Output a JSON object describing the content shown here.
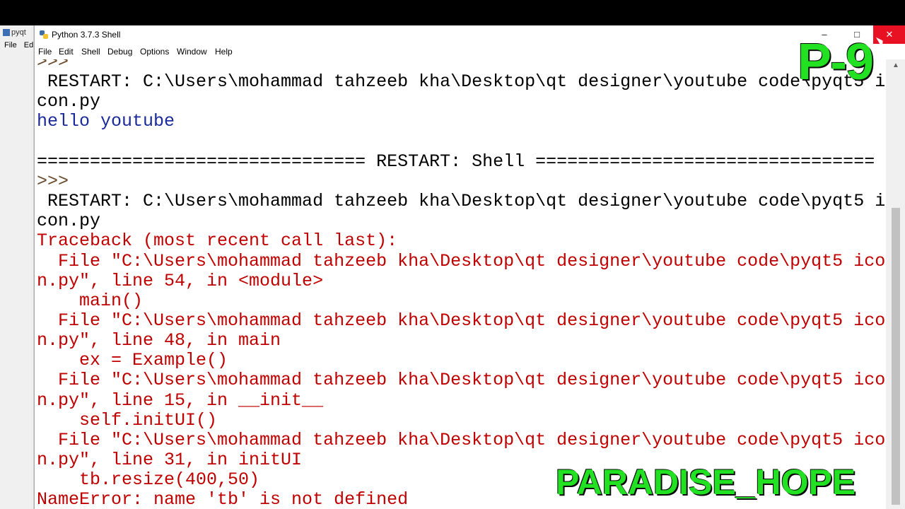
{
  "background_window": {
    "title": "pyqt",
    "menu": [
      "File",
      "Ed"
    ]
  },
  "window": {
    "title": "Python 3.7.3 Shell",
    "controls": {
      "minimize": "–",
      "maximize": "□",
      "close": "✕"
    }
  },
  "menubar": [
    "File",
    "Edit",
    "Shell",
    "Debug",
    "Options",
    "Window",
    "Help"
  ],
  "console_lines": [
    {
      "text": ">>>",
      "style": "prompt"
    },
    {
      "text": " RESTART: C:\\Users\\mohammad tahzeeb kha\\Desktop\\qt designer\\youtube code\\pyqt5 i",
      "style": "black"
    },
    {
      "text": "con.py",
      "style": "black"
    },
    {
      "text": "hello youtube",
      "style": "blue"
    },
    {
      "text": "",
      "style": "black"
    },
    {
      "text": "=============================== RESTART: Shell ================================",
      "style": "black"
    },
    {
      "text": ">>>",
      "style": "prompt"
    },
    {
      "text": " RESTART: C:\\Users\\mohammad tahzeeb kha\\Desktop\\qt designer\\youtube code\\pyqt5 i",
      "style": "black"
    },
    {
      "text": "con.py",
      "style": "black"
    },
    {
      "text": "Traceback (most recent call last):",
      "style": "red"
    },
    {
      "text": "  File \"C:\\Users\\mohammad tahzeeb kha\\Desktop\\qt designer\\youtube code\\pyqt5 ico",
      "style": "red"
    },
    {
      "text": "n.py\", line 54, in <module>",
      "style": "red"
    },
    {
      "text": "    main()",
      "style": "red"
    },
    {
      "text": "  File \"C:\\Users\\mohammad tahzeeb kha\\Desktop\\qt designer\\youtube code\\pyqt5 ico",
      "style": "red"
    },
    {
      "text": "n.py\", line 48, in main",
      "style": "red"
    },
    {
      "text": "    ex = Example()",
      "style": "red"
    },
    {
      "text": "  File \"C:\\Users\\mohammad tahzeeb kha\\Desktop\\qt designer\\youtube code\\pyqt5 ico",
      "style": "red"
    },
    {
      "text": "n.py\", line 15, in __init__",
      "style": "red"
    },
    {
      "text": "    self.initUI()",
      "style": "red"
    },
    {
      "text": "  File \"C:\\Users\\mohammad tahzeeb kha\\Desktop\\qt designer\\youtube code\\pyqt5 ico",
      "style": "red"
    },
    {
      "text": "n.py\", line 31, in initUI",
      "style": "red"
    },
    {
      "text": "    tb.resize(400,50)",
      "style": "red"
    },
    {
      "text": "NameError: name 'tb' is not defined",
      "style": "red"
    }
  ],
  "overlays": {
    "episode": "P-9",
    "brand": "PARADISE_HOPE"
  },
  "icons": {
    "title_icon": "python-icon",
    "close": "close-icon"
  },
  "colors": {
    "error_text": "#c00000",
    "output_text": "#1a2a9a",
    "overlay_green": "#22e022",
    "close_button": "#e81123"
  }
}
